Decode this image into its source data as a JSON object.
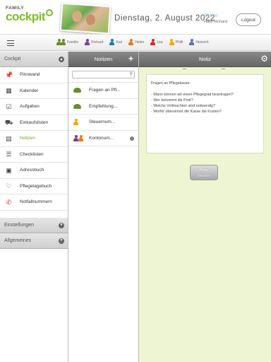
{
  "header": {
    "logo_small": "FAMILY",
    "logo_big": "cockpit",
    "date": "Dienstag, 2. August 2022",
    "user_name": "Blume",
    "user_hello": "Hallo Richard",
    "logout_label": "Logout"
  },
  "family": {
    "members": [
      {
        "name": "Familie",
        "color": "#6b8c2a"
      },
      {
        "name": "Richard",
        "color": "#7a3e98"
      },
      {
        "name": "Karl",
        "color": "#1f76b4"
      },
      {
        "name": "Helen",
        "color": "#e57a1f"
      },
      {
        "name": "Lea",
        "color": "#d62828"
      },
      {
        "name": "Philli",
        "color": "#f0a800"
      },
      {
        "name": "Heinrich",
        "color": "#5b6db0"
      }
    ]
  },
  "sidebar": {
    "section_title": "Cockpit",
    "items": [
      {
        "label": "Pinnwand",
        "icon": "pin-icon"
      },
      {
        "label": "Kalender",
        "icon": "calendar-icon"
      },
      {
        "label": "Aufgaben",
        "icon": "tasks-icon"
      },
      {
        "label": "Einkaufslisten",
        "icon": "cart-icon"
      },
      {
        "label": "Notizen",
        "icon": "notes-icon"
      },
      {
        "label": "Checklisten",
        "icon": "checklist-icon"
      },
      {
        "label": "Adressbuch",
        "icon": "addressbook-icon"
      },
      {
        "label": "Pflegetagebuch",
        "icon": "heart-icon"
      },
      {
        "label": "Notfallnummern",
        "icon": "phone-icon"
      }
    ],
    "settings_title": "Einstellungen",
    "general_title": "Allgemeines"
  },
  "notes": {
    "title": "Notizen",
    "search_placeholder": "",
    "items": [
      {
        "label": "Fragen an Pfl...",
        "icon": "family-icon"
      },
      {
        "label": "Empfehlung...",
        "icon": "family-icon"
      },
      {
        "label": "Steuernum...",
        "icon": "philli-icon"
      },
      {
        "label": "Kontonum...",
        "icon": "richard-helen-icon"
      }
    ]
  },
  "note": {
    "title": "Notiz",
    "heading": "Fragen an Pflegekasse:",
    "lines": [
      "- Wann können wir einen Pflegegrad beantragen?",
      "- Wer bekommt die Post?",
      "- Welche Vollmachten sind notwendig?",
      "- Worfür übernimmt die Kasse die Kosten?"
    ],
    "delete_label_1": "Notiz",
    "delete_label_2": "löschen"
  }
}
